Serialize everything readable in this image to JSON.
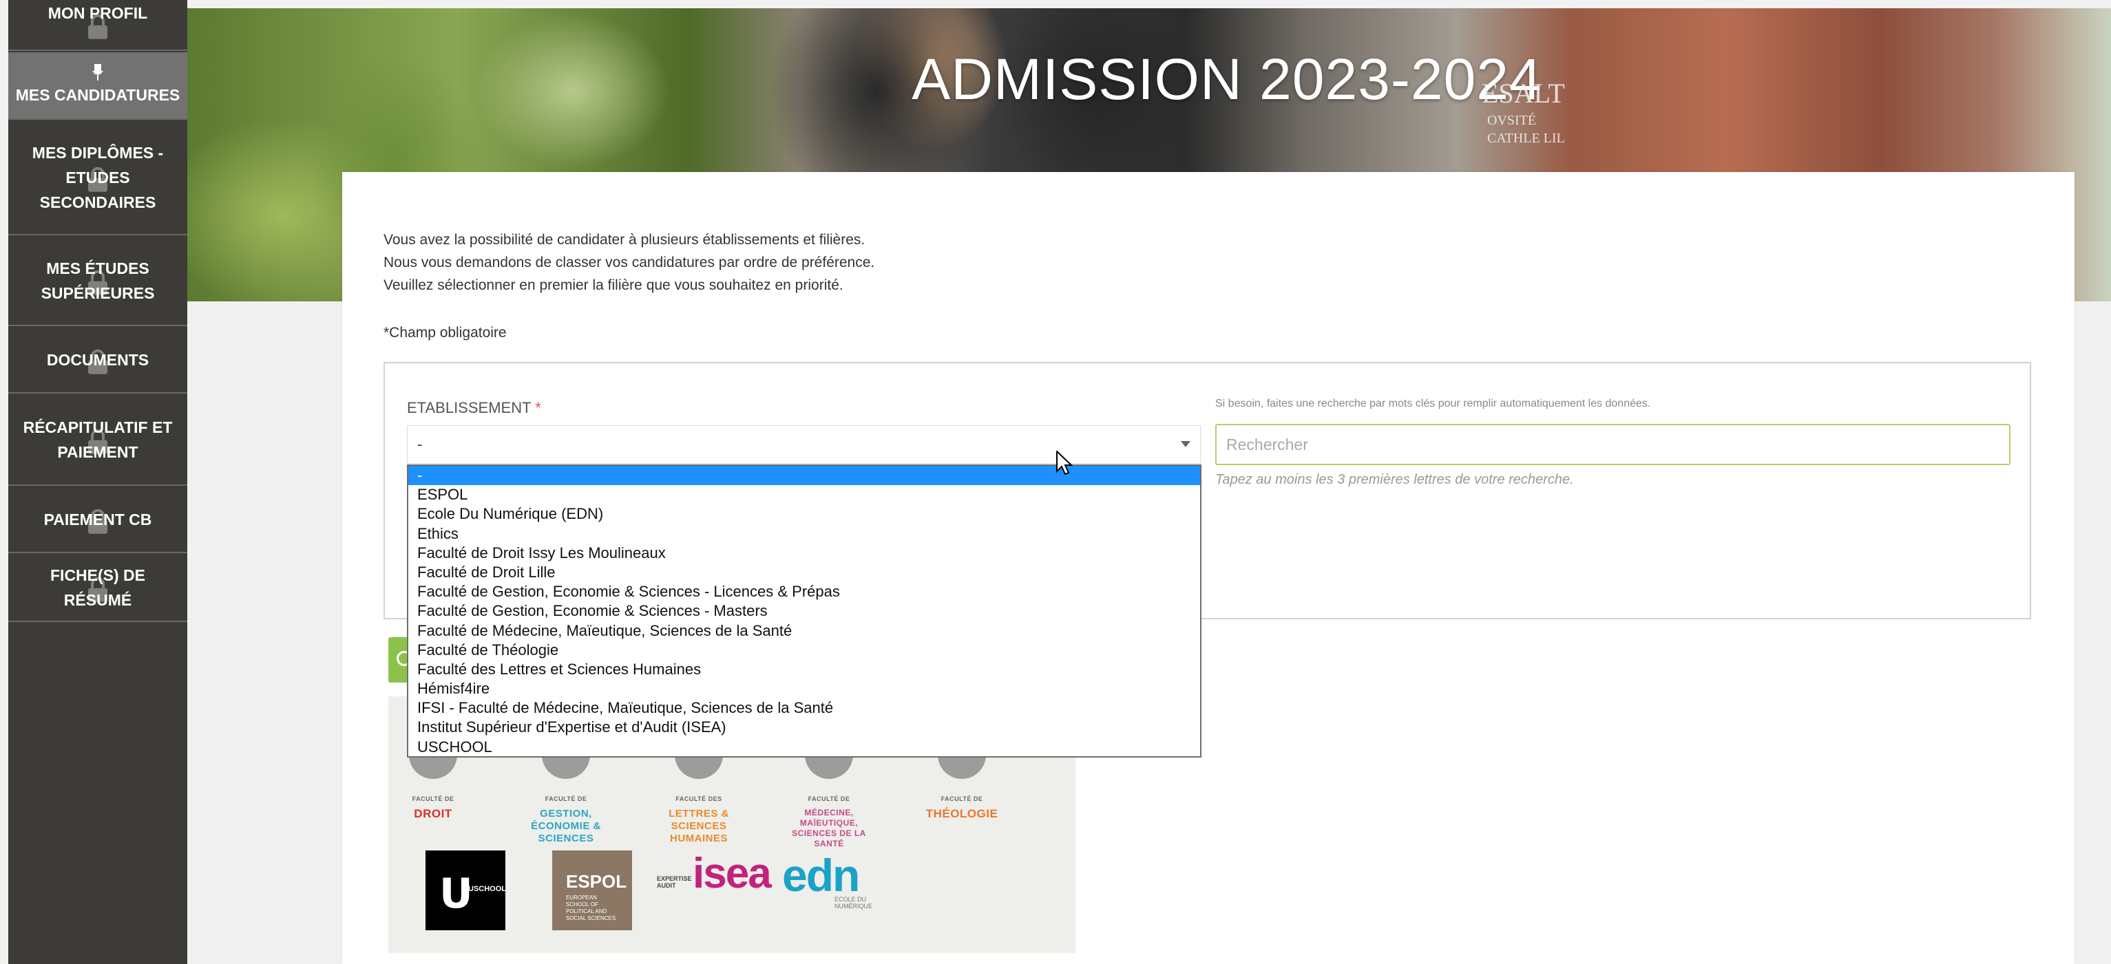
{
  "sidebar": {
    "items": [
      {
        "label": "MON PROFIL"
      },
      {
        "label": "MES CANDIDATURES"
      },
      {
        "label": "MES DIPLÔMES - ETUDES SECONDAIRES"
      },
      {
        "label": "MES ÉTUDES SUPÉRIEURES"
      },
      {
        "label": "DOCUMENTS"
      },
      {
        "label": "RÉCAPITULATIF ET PAIEMENT"
      },
      {
        "label": "PAIEMENT CB"
      },
      {
        "label": "FICHE(S) DE RÉSUMÉ"
      }
    ]
  },
  "hero": {
    "title": "ADMISSION 2023-2024",
    "bg_text1": "ESALT",
    "bg_text2": "OVSITÉ\nCATHLE LIL"
  },
  "intro": {
    "line1": "Vous avez la possibilité de candidater à plusieurs établissements et filières.",
    "line2": "Nous vous demandons de classer vos candidatures par ordre de préférence.",
    "line3": "Veuillez sélectionner en premier la filière que vous souhaitez en priorité."
  },
  "required_note": "*Champ obligatoire",
  "form": {
    "etablissement_label": "ETABLISSEMENT",
    "required_mark": "*",
    "selected_value": "-",
    "search_hint": "Si besoin, faites une recherche par mots clés pour remplir automatiquement les données.",
    "search_placeholder": "Rechercher",
    "search_help": "Tapez au moins les 3 premières lettres de votre recherche."
  },
  "dropdown_options": [
    "-",
    "ESPOL",
    "Ecole Du Numérique (EDN)",
    "Ethics",
    "Faculté de Droit Issy Les Moulineaux",
    "Faculté de Droit Lille",
    "Faculté de Gestion, Economie & Sciences - Licences & Prépas",
    "Faculté de Gestion, Economie & Sciences - Masters",
    "Faculté de Médecine, Maïeutique, Sciences de la Santé",
    "Faculté de Théologie",
    "Faculté des Lettres et Sciences Humaines",
    "Hémisf4ire",
    "IFSI - Faculté de Médecine, Maïeutique, Sciences de la Santé",
    "Institut Supérieur d'Expertise et d'Audit (ISEA)",
    "USCHOOL"
  ],
  "logos": {
    "droit": {
      "pre": "FACULTÉ DE",
      "name": "DROIT",
      "color": "#d9302c"
    },
    "gestion": {
      "pre": "FACULTÉ DE",
      "name": "GESTION, ÉCONOMIE & SCIENCES",
      "color": "#2aa6c4"
    },
    "lettres": {
      "pre": "FACULTÉ DES",
      "name": "LETTRES & SCIENCES HUMAINES",
      "color": "#e98a2a"
    },
    "medecine": {
      "pre": "FACULTÉ DE",
      "name": "MÉDECINE, MAÏEUTIQUE, SCIENCES DE LA SANTÉ",
      "color": "#c44a8a"
    },
    "theologie": {
      "pre": "FACULTÉ DE",
      "name": "THÉOLOGIE",
      "color": "#e9782a"
    },
    "uschool": {
      "mark": "U",
      "text": "USCHOOL"
    },
    "espol": {
      "name": "ESPOL",
      "sub": "EUROPEAN SCHOOL OF POLITICAL AND SOCIAL SCIENCES"
    },
    "isea": {
      "name": "isea",
      "sub": "EXPERTISE AUDIT"
    },
    "edn": {
      "name": "edn",
      "sub": "ECOLE DU NUMÉRIQUE"
    }
  },
  "colors": {
    "sidebar_bg": "#3c3b37",
    "sidebar_active": "#737272",
    "selected_option": "#1e90ff",
    "search_border": "#b5cf6a",
    "green_button": "#8bc34a"
  }
}
